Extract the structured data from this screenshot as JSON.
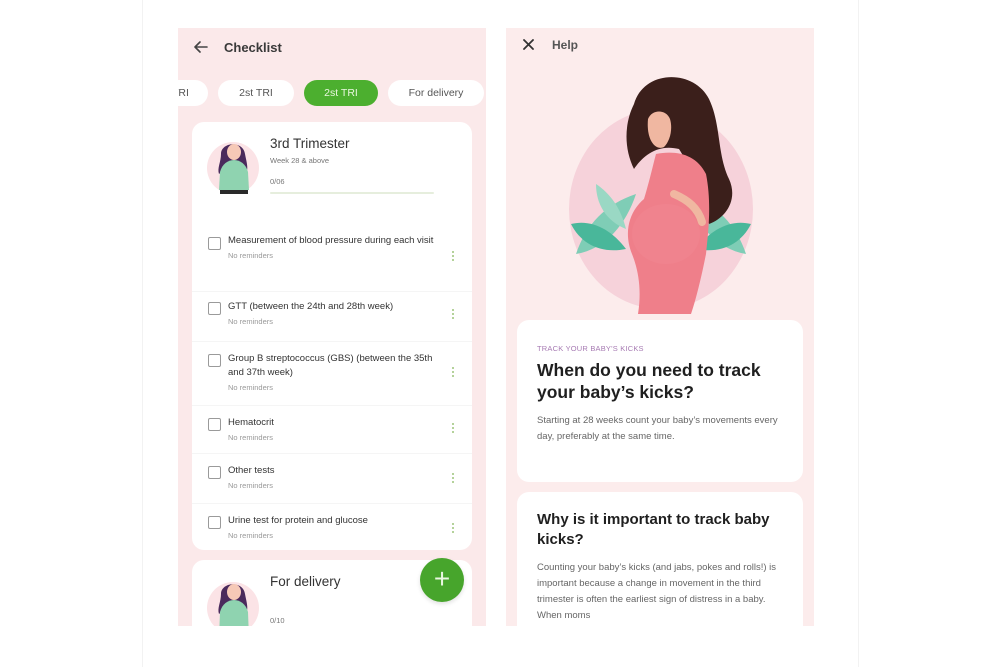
{
  "left_screen": {
    "header": {
      "title": "Checklist",
      "back_icon": "arrow-left"
    },
    "tabs": [
      {
        "label": "TRI",
        "active": false
      },
      {
        "label": "2st TRI",
        "active": false
      },
      {
        "label": "2st TRI",
        "active": true
      },
      {
        "label": "For delivery",
        "active": false
      },
      {
        "label": "",
        "active": false
      }
    ],
    "trimester_card": {
      "title": "3rd Trimester",
      "subtitle": "Week 28 & above",
      "count": "0/06",
      "progress": 0,
      "tasks": [
        {
          "title": "Measurement of blood pressure during each visit",
          "reminder": "No reminders"
        },
        {
          "title": "GTT (between the 24th and 28th week)",
          "reminder": "No reminders"
        },
        {
          "title": "Group B streptococcus (GBS) (between the 35th and 37th week)",
          "reminder": "No reminders"
        },
        {
          "title": "Hematocrit",
          "reminder": "No reminders"
        },
        {
          "title": "Other tests",
          "reminder": "No reminders"
        },
        {
          "title": "Urine test for protein and glucose",
          "reminder": "No reminders"
        }
      ]
    },
    "delivery_card": {
      "title": "For delivery",
      "count": "0/10"
    },
    "fab": {
      "label": "+",
      "icon": "plus"
    }
  },
  "right_screen": {
    "header": {
      "title": "Help",
      "close_icon": "close"
    },
    "hero_image": "pregnant-woman-illustration",
    "sections": [
      {
        "kicker": "TRACK YOUR BABY'S KICKS",
        "heading": "When do you need to track your baby’s kicks?",
        "body": "Starting at 28 weeks count your baby’s movements every day, preferably at the same time."
      },
      {
        "kicker": "",
        "heading": "Why is it important to track baby kicks?",
        "body": "Counting your baby’s kicks (and jabs, pokes and rolls!) is important because a change in movement in the third trimester is often the earliest sign of distress in a baby. When moms"
      }
    ]
  },
  "colors": {
    "accent_green": "#4caf2f",
    "screen_bg": "#fbe9ea",
    "kicker_purple": "#a77bb3"
  }
}
